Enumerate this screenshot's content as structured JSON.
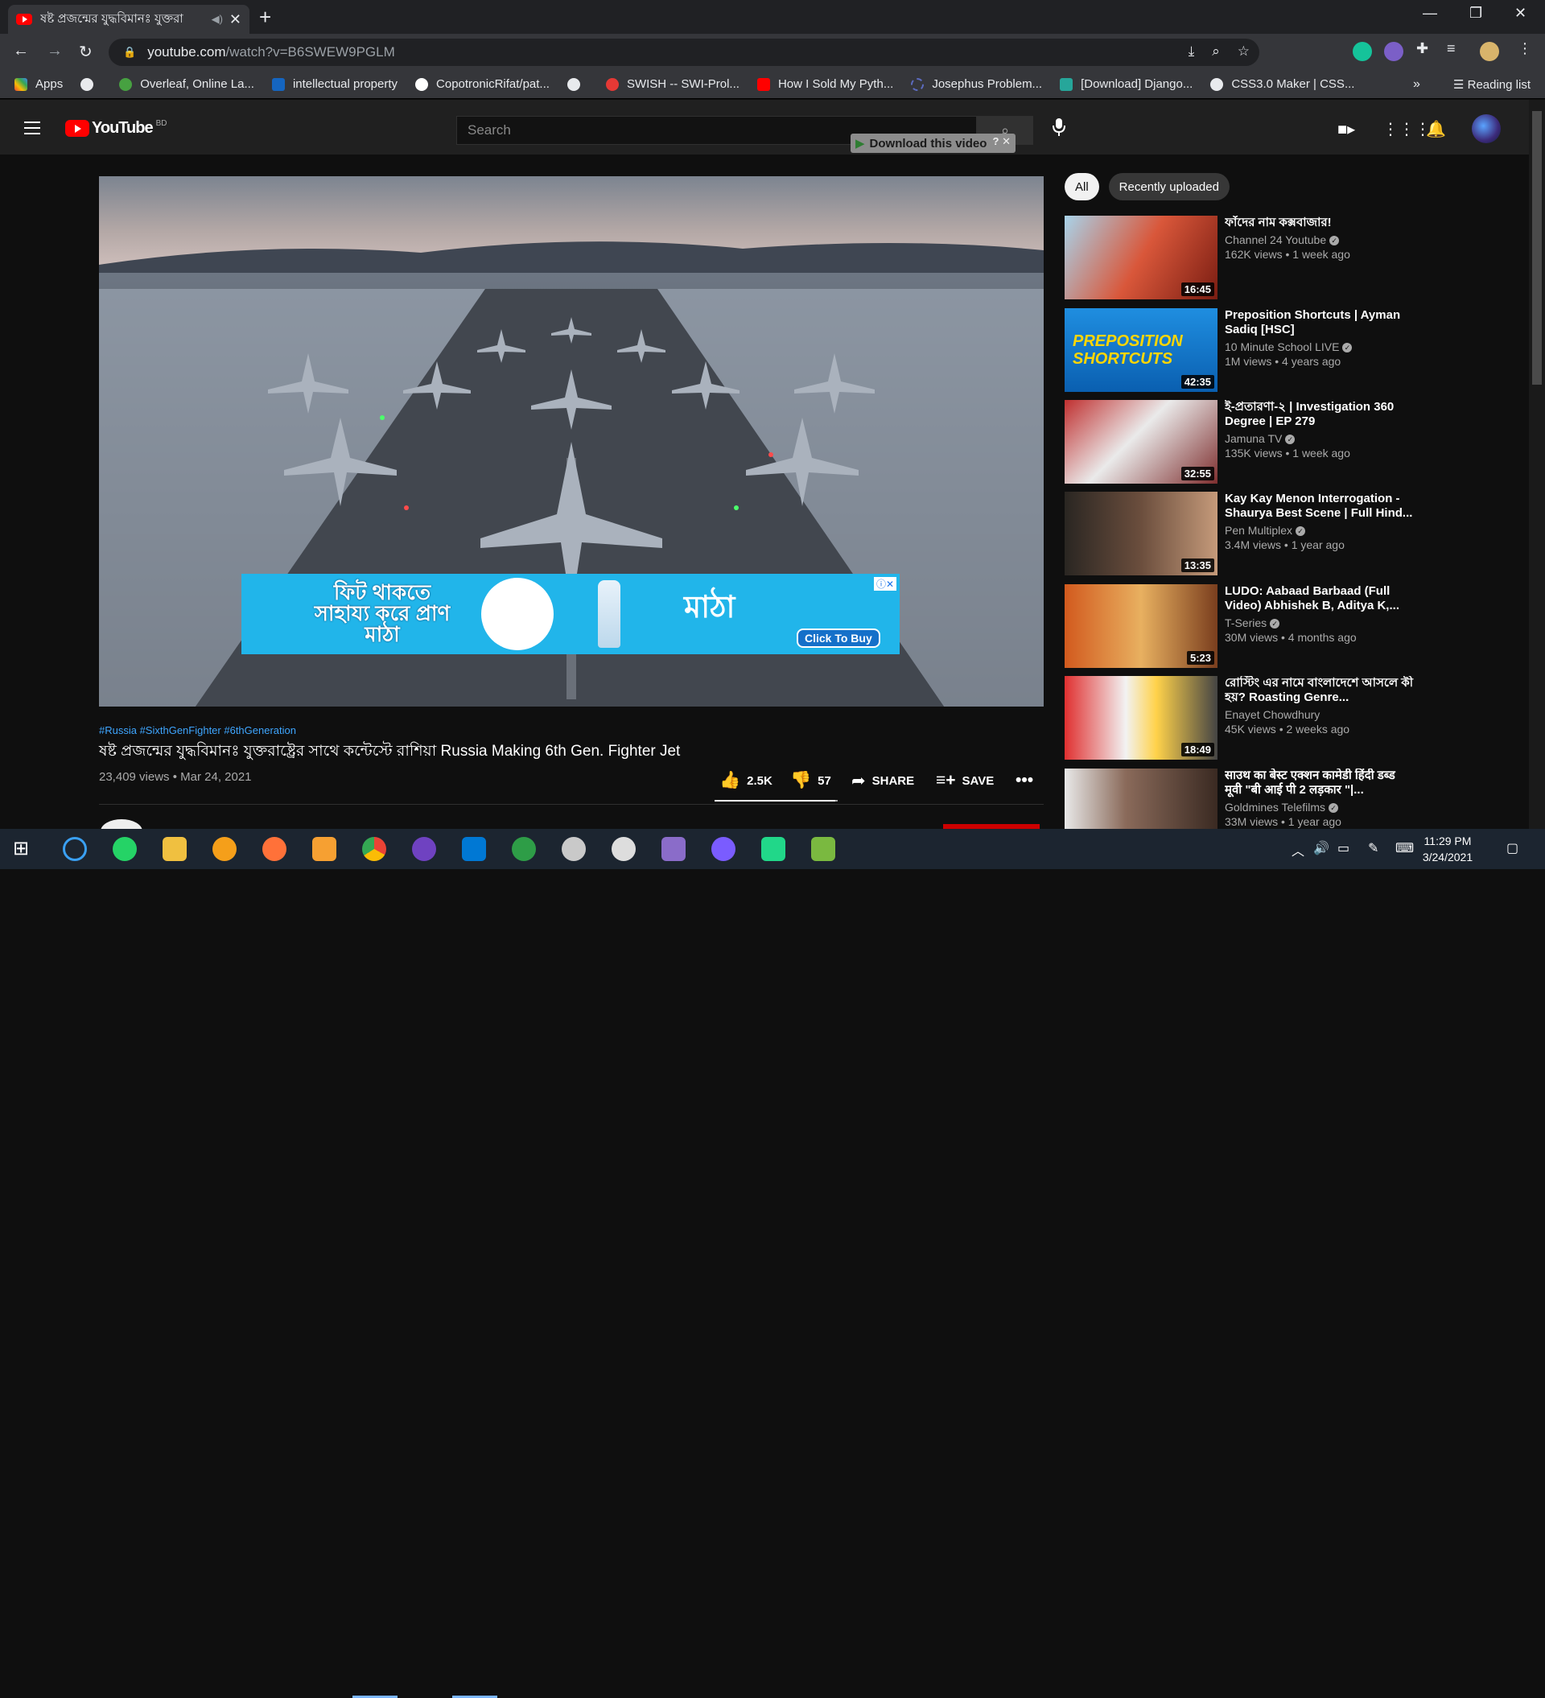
{
  "browser": {
    "tab_title": "ষষ্ট প্রজন্মের যুদ্ধবিমানঃ যুক্তরা",
    "url_host": "youtube.com",
    "url_path": "/watch?v=B6SWEW9PGLM",
    "bookmarks": [
      {
        "label": "Apps",
        "color": "#ea4335"
      },
      {
        "label": "",
        "color": "#e8eaed"
      },
      {
        "label": "Overleaf, Online La...",
        "color": "#47a141"
      },
      {
        "label": "intellectual property",
        "color": "#1565c0"
      },
      {
        "label": "CopotronicRifat/pat...",
        "color": "#ffffff"
      },
      {
        "label": "",
        "color": "#e8eaed"
      },
      {
        "label": "SWISH -- SWI-Prol...",
        "color": "#e53935"
      },
      {
        "label": "How I Sold My Pyth...",
        "color": "#ff0000"
      },
      {
        "label": "Josephus Problem...",
        "color": "#5c6bc0"
      },
      {
        "label": "[Download] Django...",
        "color": "#26a69a"
      },
      {
        "label": "CSS3.0 Maker | CSS...",
        "color": "#e8eaed"
      }
    ],
    "reading_list": "Reading list"
  },
  "youtube": {
    "logo_text": "YouTube",
    "country": "BD",
    "search_placeholder": "Search",
    "download_bar": "Download this video",
    "video": {
      "hashtags": "#Russia #SixthGenFighter #6thGeneration",
      "title": "ষষ্ট প্রজন্মের যুদ্ধবিমানঃ যুক্তরাষ্ট্রের সাথে কন্টেস্টে রাশিয়া Russia Making 6th Gen. Fighter Jet",
      "views_date": "23,409 views • Mar 24, 2021",
      "likes": "2.5K",
      "dislikes": "57",
      "share": "SHARE",
      "save": "SAVE",
      "like_ratio": 0.98
    },
    "ad": {
      "text": "ফিট থাকতে সাহায্য করে প্রাণ মাঠা",
      "brand": "মাঠা",
      "cta": "Click To Buy"
    },
    "chips": [
      "All",
      "Recently uploaded"
    ],
    "recommendations": [
      {
        "title": "ফাঁদের নাম কক্সবাজার!",
        "channel": "Channel 24 Youtube",
        "meta": "162K views • 1 week ago",
        "duration": "16:45"
      },
      {
        "title": "Preposition Shortcuts | Ayman Sadiq [HSC]",
        "channel": "10 Minute School LIVE",
        "meta": "1M views • 4 years ago",
        "duration": "42:35",
        "thumb_text": "PREPOSITION SHORTCUTS"
      },
      {
        "title": "ই-প্রতারণা-২ | Investigation 360 Degree | EP 279",
        "channel": "Jamuna TV",
        "meta": "135K views • 1 week ago",
        "duration": "32:55"
      },
      {
        "title": "Kay Kay Menon Interrogation - Shaurya Best Scene | Full Hind...",
        "channel": "Pen Multiplex",
        "meta": "3.4M views • 1 year ago",
        "duration": "13:35"
      },
      {
        "title": "LUDO: Aabaad Barbaad (Full Video) Abhishek B, Aditya K,...",
        "channel": "T-Series",
        "meta": "30M views • 4 months ago",
        "duration": "5:23"
      },
      {
        "title": "রোস্টিং এর নামে বাংলাদেশে আসলে কী হয়? Roasting Genre...",
        "channel": "Enayet Chowdhury",
        "meta": "45K views • 2 weeks ago",
        "duration": "18:49"
      },
      {
        "title": "साउथ का बेस्ट एक्शन कामेडी हिंदी डब्ड मूवी \"बी आई पी 2 लड़कार \"|...",
        "channel": "Goldmines Telefilms",
        "meta": "33M views • 1 year ago",
        "duration": ""
      }
    ]
  },
  "taskbar": {
    "time": "11:29 PM",
    "date": "3/24/2021"
  },
  "colors": {
    "bg": "#0f0f0f",
    "accent_red": "#ff0000",
    "link_blue": "#3ea6ff"
  }
}
